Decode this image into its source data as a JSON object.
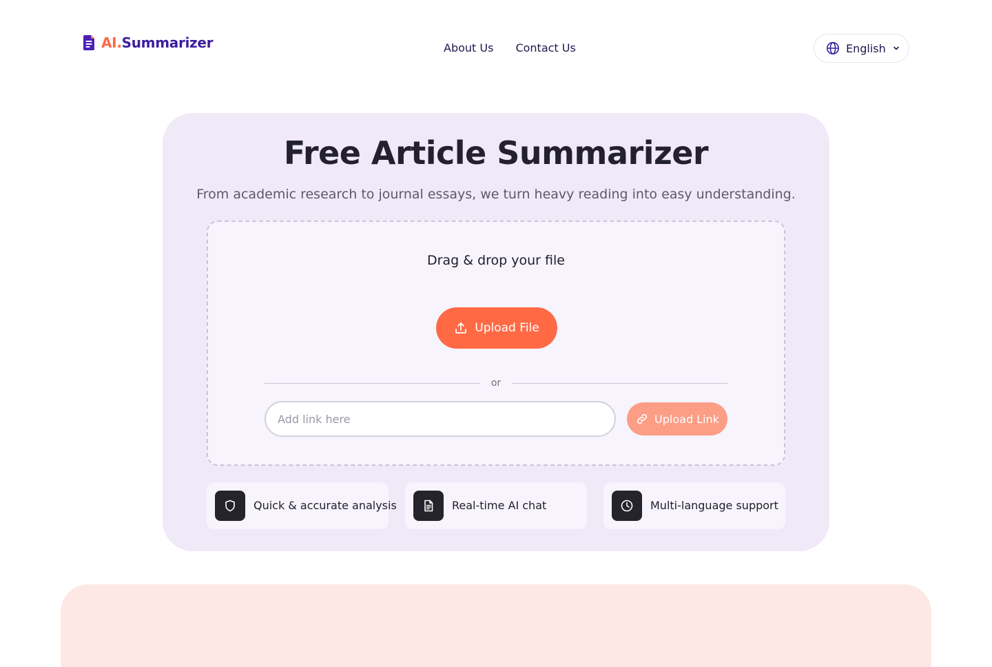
{
  "header": {
    "logo": {
      "prefix": "AI.",
      "name": "Summarizer"
    },
    "nav": [
      {
        "label": "About Us"
      },
      {
        "label": "Contact Us"
      }
    ],
    "language": {
      "label": "English",
      "icon": "globe-icon"
    }
  },
  "hero": {
    "title": "Free Article Summarizer",
    "subtitle": "From academic research to journal essays, we turn heavy reading into easy understanding.",
    "dropzone": {
      "title": "Drag & drop your file",
      "upload_label": "Upload File",
      "or_text": "or",
      "link_placeholder": "Add link here",
      "link_value": "",
      "link_button_label": "Upload Link"
    },
    "features": [
      {
        "label": "Quick & accurate analysis",
        "icon": "shield-icon"
      },
      {
        "label": "Real-time AI chat",
        "icon": "document-icon"
      },
      {
        "label": "Multi-language support",
        "icon": "clock-icon"
      }
    ]
  },
  "colors": {
    "accent": "#ff6a45",
    "brand": "#3c1e9e",
    "hero_bg": "#efe9f8",
    "link_button": "#fc9d86",
    "bottom_bg": "#fde8e5"
  }
}
